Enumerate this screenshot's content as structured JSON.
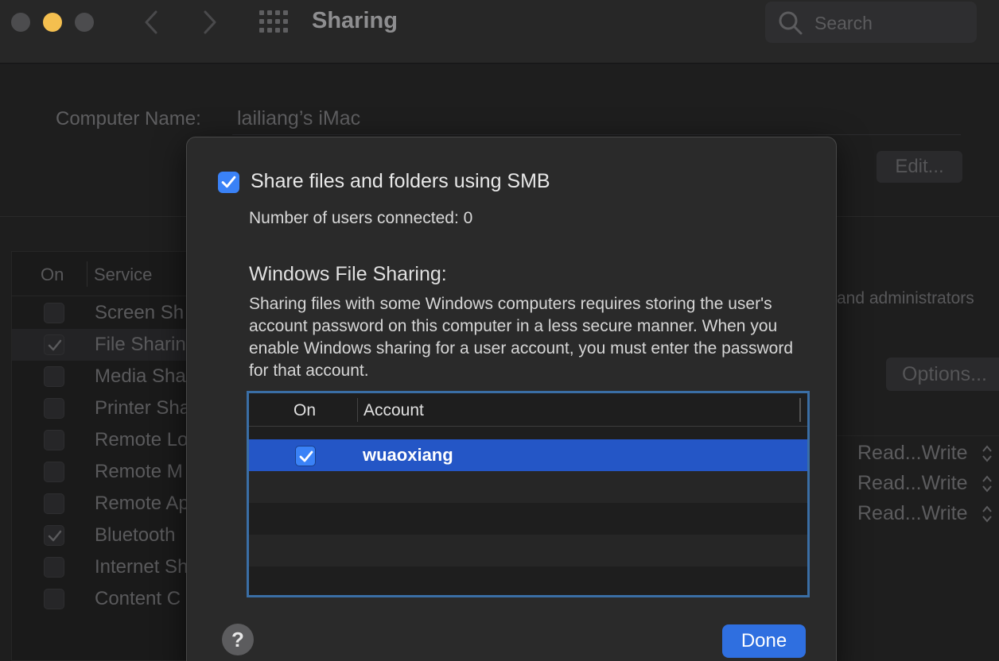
{
  "window": {
    "title": "Sharing"
  },
  "search": {
    "placeholder": "Search"
  },
  "computer_name": {
    "label": "Computer Name:",
    "value": "lailiang’s iMac",
    "edit_label": "Edit..."
  },
  "services": {
    "header": {
      "on": "On",
      "service": "Service"
    },
    "items": [
      {
        "name": "Screen Sh",
        "checked": false
      },
      {
        "name": "File Sharin",
        "checked": true
      },
      {
        "name": "Media Sha",
        "checked": false
      },
      {
        "name": "Printer Sha",
        "checked": false
      },
      {
        "name": "Remote Lo",
        "checked": false
      },
      {
        "name": "Remote M",
        "checked": false
      },
      {
        "name": "Remote Ap",
        "checked": false
      },
      {
        "name": "Bluetooth",
        "checked": true
      },
      {
        "name": "Internet Sh",
        "checked": false
      },
      {
        "name": "Content C",
        "checked": false
      }
    ]
  },
  "background": {
    "note": "and administrators",
    "options_label": "Options...",
    "permissions": [
      "Read...Write",
      "Read...Write",
      "Read...Write"
    ]
  },
  "sheet": {
    "smb_label": "Share files and folders using SMB",
    "smb_checked": true,
    "users_connected": "Number of users connected: 0",
    "wfs_title": "Windows File Sharing:",
    "wfs_description": "Sharing files with some Windows computers requires storing the user's account password on this computer in a less secure manner. When you enable Windows sharing for a user account, you must enter the password for that account.",
    "table": {
      "header_on": "On",
      "header_account": "Account",
      "rows": [
        {
          "account": "wuaoxiang",
          "on": true
        }
      ]
    },
    "help_label": "?",
    "done_label": "Done"
  },
  "colors": {
    "accent": "#2f6fe0",
    "selection": "#2456c6",
    "checkbox": "#3a82f7",
    "minimize": "#f4bf4f"
  }
}
